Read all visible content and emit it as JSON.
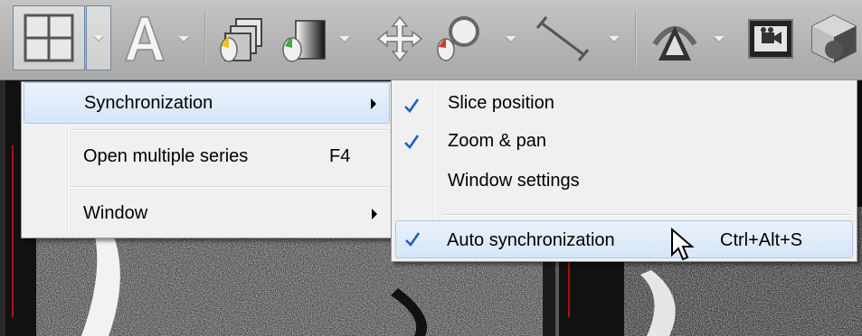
{
  "toolbar": {
    "buttons": [
      {
        "name": "layout-grid-icon"
      },
      {
        "name": "annotation-text-icon"
      },
      {
        "name": "series-stack-icon"
      },
      {
        "name": "window-level-icon"
      },
      {
        "name": "pan-move-icon"
      },
      {
        "name": "zoom-magnifier-icon"
      },
      {
        "name": "measure-line-icon"
      },
      {
        "name": "mouse-mode-icon"
      },
      {
        "name": "cine-film-icon"
      },
      {
        "name": "mpr-cube-icon"
      }
    ]
  },
  "main_menu": {
    "items": [
      {
        "label": "Synchronization",
        "shortcut": "",
        "has_submenu": true,
        "highlighted": true
      },
      {
        "label": "Open multiple series",
        "shortcut": "F4",
        "has_submenu": false,
        "highlighted": false
      },
      {
        "label": "Window",
        "shortcut": "",
        "has_submenu": true,
        "highlighted": false
      }
    ]
  },
  "sync_submenu": {
    "items": [
      {
        "label": "Slice position",
        "checked": true,
        "shortcut": ""
      },
      {
        "label": "Zoom & pan",
        "checked": true,
        "shortcut": ""
      },
      {
        "label": "Window settings",
        "checked": false,
        "shortcut": ""
      },
      {
        "label": "Auto synchronization",
        "checked": true,
        "shortcut": "Ctrl+Alt+S",
        "highlighted": true
      }
    ]
  },
  "colors": {
    "accent_check": "#1f5fbf",
    "menu_background": "#f0f0f0",
    "highlight_border": "#a8c8ec"
  }
}
